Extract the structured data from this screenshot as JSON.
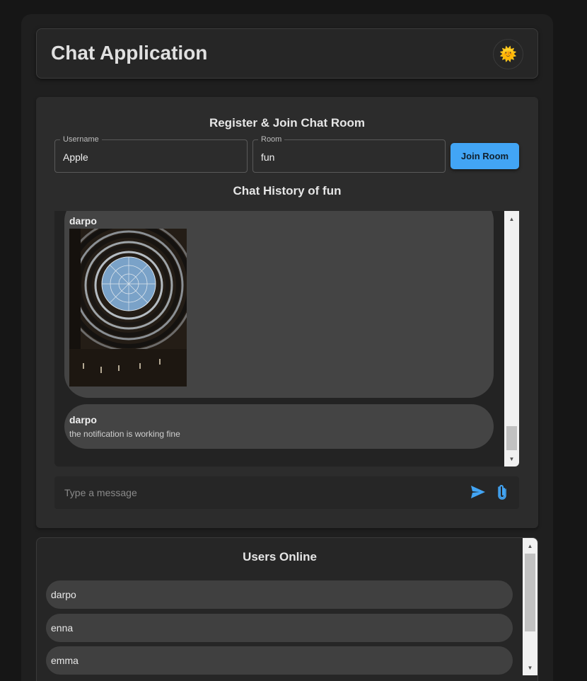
{
  "header": {
    "title": "Chat Application",
    "theme_toggle_icon": "sun-face-icon",
    "theme_toggle_glyph": "🌞"
  },
  "register": {
    "title": "Register & Join Chat Room",
    "username": {
      "label": "Username",
      "value": "Apple"
    },
    "room": {
      "label": "Room",
      "value": "fun"
    },
    "join_button": "Join Room"
  },
  "chat": {
    "history_title": "Chat History of fun",
    "messages": [
      {
        "user": "darpo",
        "type": "image",
        "image_desc_icon": "image-attachment"
      },
      {
        "user": "darpo",
        "type": "text",
        "text": "the notification is working fine"
      }
    ],
    "input_placeholder": "Type a message",
    "send_icon": "send-icon",
    "attach_icon": "paperclip-icon"
  },
  "users_online": {
    "title": "Users Online",
    "users": [
      "darpo",
      "enna",
      "emma"
    ]
  },
  "colors": {
    "accent": "#42a5f5",
    "background": "#161616",
    "card": "#2c2c2c",
    "bubble": "#444444"
  }
}
